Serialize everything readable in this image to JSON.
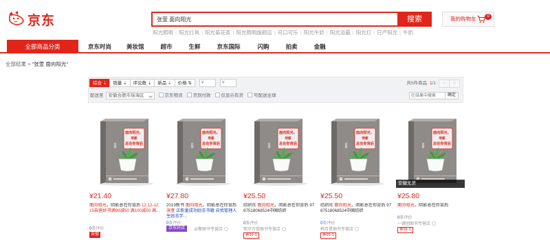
{
  "header": {
    "logo_text": "京东",
    "search_value": "张萱 面向阳光",
    "search_button": "搜索",
    "hot_words": [
      "阳光照明",
      "阳光灯具",
      "阳光菊花茶",
      "阳光照明旗舰店",
      "可口可乐",
      "阳光牛奶",
      "阳光浴霸",
      "阳光灯",
      "日产阳光",
      "牛奶"
    ],
    "cart_label": "我的购物车",
    "cart_count": "0"
  },
  "nav": {
    "all_categories": "全部商品分类",
    "items": [
      "京东时尚",
      "美妆馆",
      "超市",
      "生鲜",
      "京东国际",
      "闪购",
      "拍卖",
      "金融"
    ]
  },
  "breadcrumb": {
    "root": "全部结果",
    "sep": ">",
    "query": "\"张萱 面向阳光\""
  },
  "filter": {
    "sorts": [
      "综合",
      "销量",
      "评论数",
      "新品",
      "价格"
    ],
    "price_from": "¥",
    "price_to": "¥",
    "price_dash": "-",
    "total_text": "共5件商品",
    "page_current": "1",
    "page_total": "/1",
    "prev": "<",
    "next": ">",
    "ship_label": "配送至",
    "ship_addr": "安徽合肥市瑶海区",
    "checkboxes": [
      "京东物流",
      "货到付款",
      "仅显示有货",
      "可配送全球"
    ],
    "instore_placeholder": "在结果中搜索",
    "instore_button": "确定"
  },
  "book_cover": {
    "title_lines": [
      "面向阳光，",
      "明都",
      "总在你背后"
    ],
    "author": "张萱"
  },
  "products": [
    {
      "price": "¥21.40",
      "title_highlight": "面向阳光",
      "title_rest": "，阴影总在你背后",
      "title_ad": " 12.12-12.15自营好书满99减50 满100减50 满...",
      "reviews_count": "0",
      "reviews_suffix": "条评价",
      "shop": "",
      "badge": "自营",
      "coupon": ""
    },
    {
      "price": "¥27.80",
      "title_prefix": "2019新书 ",
      "title_highlight": "面向阳光",
      "title_rest": "，阴影总在你背后",
      "title_ad": " 张萱 ",
      "title_ad2": "正能量成功励志书籍 自我管理人生励志学...",
      "reviews_count": "0",
      "reviews_suffix": "条评价",
      "badge_jd": "京东好店",
      "shop": "云聚图书专营店",
      "coupon": ""
    },
    {
      "price": "¥25.50",
      "title_prefix": "纺织社 ",
      "title_highlight": "面向阳光",
      "title_rest": "，阴影总在你背后 9787518068524中国纺织",
      "reviews_count": "0",
      "reviews_suffix": "条评价",
      "shop": "熙华万卷图书专营店",
      "coupon": "券99-3"
    },
    {
      "price": "¥25.50",
      "title_prefix": "纺织社 ",
      "title_highlight": "面向阳光",
      "title_rest": "，阴影总在你背后 9787518068524中国纺织",
      "reviews_count": "0",
      "reviews_suffix": "条评价",
      "shop": "韩月星图书专营店",
      "coupon": "券99-3"
    },
    {
      "price": "¥25.80",
      "title_highlight": "面向阳光",
      "title_rest": "，阴影总在你背后",
      "reviews_count": "0",
      "reviews_suffix": "条评价",
      "shop": "一键团图书专营店",
      "coupon": "券99-3",
      "image_label": "安徽无货"
    }
  ],
  "colors": {
    "brand_red": "#e1251b",
    "cover_gray": "#8f8b88",
    "plant_green": "#3f9a3c"
  }
}
